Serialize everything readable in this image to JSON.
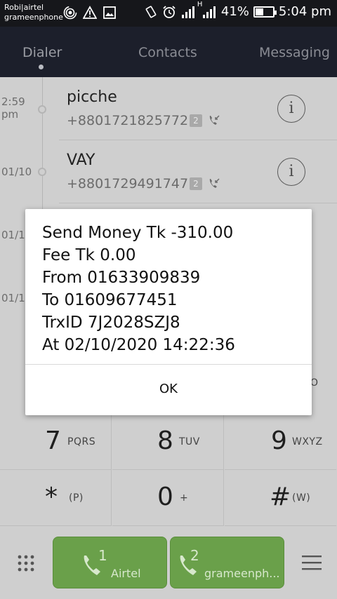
{
  "status_bar": {
    "carrier_1": "Robi|airtel",
    "carrier_2": "grameenphone",
    "network_label": "H",
    "battery_percent": "41%",
    "battery_level": 0.41,
    "time": "5:04 pm",
    "icons": [
      "hotspot-icon",
      "warning-icon",
      "image-icon",
      "vibrate-icon",
      "alarm-icon",
      "signal-icon",
      "signal-icon"
    ]
  },
  "tabs": [
    {
      "label": "Dialer",
      "active": true
    },
    {
      "label": "Contacts",
      "active": false
    },
    {
      "label": "Messaging",
      "active": false
    }
  ],
  "call_log": {
    "timeline": [
      {
        "label": "2:59\npm"
      },
      {
        "label": "01/10"
      },
      {
        "label": "01/1"
      },
      {
        "label": "01/1"
      }
    ],
    "entries": [
      {
        "name": "picche",
        "number": "+8801721825772",
        "sim": "2",
        "call_type_icon": "incoming-call-icon"
      },
      {
        "name": "VAY",
        "number": "+8801729491747",
        "sim": "2",
        "call_type_icon": "incoming-call-icon"
      }
    ]
  },
  "keypad": {
    "keys": [
      {
        "digit": "7",
        "letters": "PQRS"
      },
      {
        "digit": "8",
        "letters": "TUV"
      },
      {
        "digit": "9",
        "letters": "WXYZ"
      },
      {
        "digit": "*",
        "letters": "(P)"
      },
      {
        "digit": "0",
        "letters": "+"
      },
      {
        "digit": "#",
        "letters": "(W)"
      }
    ],
    "partial_hidden_label": "O"
  },
  "bottom_bar": {
    "sim_buttons": [
      {
        "num": "1",
        "label": "Airtel"
      },
      {
        "num": "2",
        "label": "grameenph..."
      }
    ],
    "accent_color": "#6aa04a"
  },
  "dialog": {
    "lines": [
      "Send Money Tk -310.00",
      "Fee Tk 0.00",
      "From 01633909839",
      "To 01609677451",
      "TrxID 7J2028SZJ8",
      "At 02/10/2020 14:22:36"
    ],
    "ok_label": "OK"
  }
}
